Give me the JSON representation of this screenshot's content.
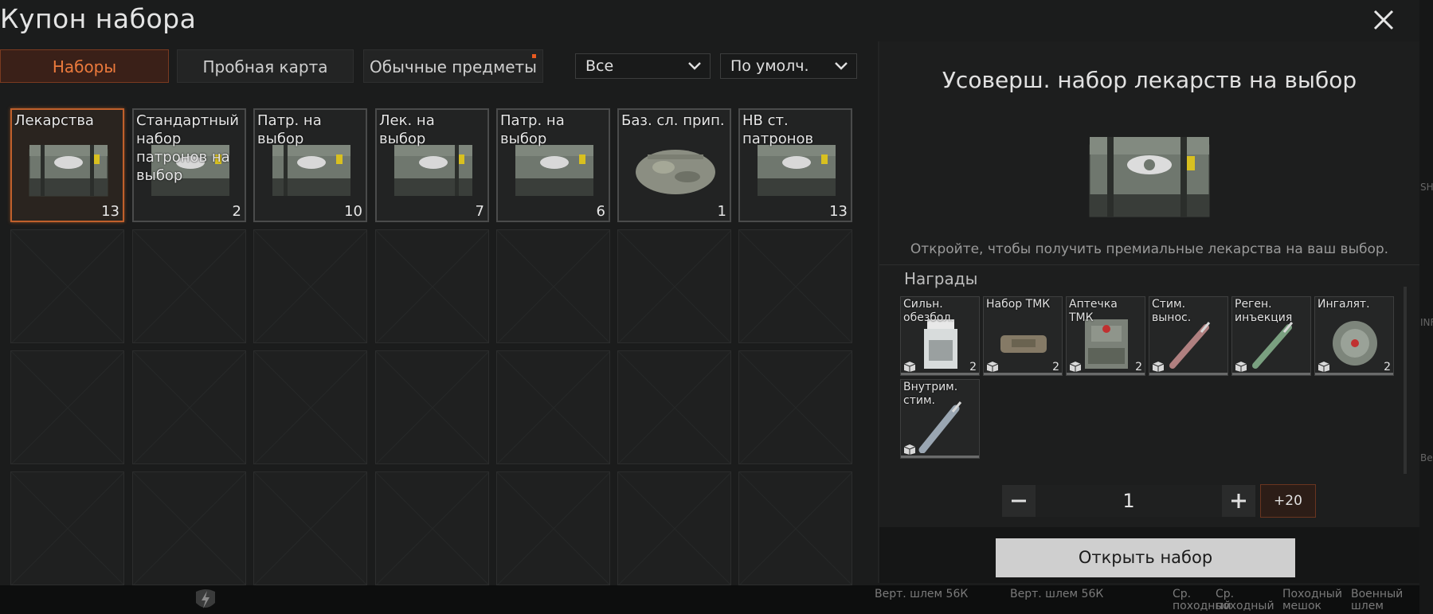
{
  "window": {
    "title": "Купон набора"
  },
  "tabs": [
    {
      "label": "Наборы",
      "active": true
    },
    {
      "label": "Пробная карта",
      "active": false
    },
    {
      "label": "Обычные предметы",
      "active": false,
      "has_dot": true
    }
  ],
  "filters": {
    "category": "Все",
    "sort": "По умолч."
  },
  "grid": {
    "items": [
      {
        "label": "Лекарства",
        "count": "13",
        "icon": "medical-crate-icon",
        "selected": true
      },
      {
        "label": "Стандартный набор патронов на выбор",
        "count": "2",
        "icon": "ammo-crate-icon"
      },
      {
        "label": "Патр. на выбор",
        "count": "10",
        "icon": "ammo-crate-icon"
      },
      {
        "label": "Лек. на выбор",
        "count": "7",
        "icon": "medical-crate-icon"
      },
      {
        "label": "Патр. на выбор",
        "count": "6",
        "icon": "ammo-crate-icon"
      },
      {
        "label": "Баз. сл. прип.",
        "count": "1",
        "icon": "duffel-bag-icon"
      },
      {
        "label": "НВ ст. патронов",
        "count": "13",
        "icon": "ammo-crate-icon"
      }
    ]
  },
  "detail": {
    "title": "Усоверш. набор лекарств на выбор",
    "description": "Откройте, чтобы получить премиальные лекарства на ваш выбор.",
    "rewards_header": "Награды",
    "rewards": [
      {
        "label": "Сильн. обезбол.",
        "count": "2",
        "icon": "painkiller-bottle-icon"
      },
      {
        "label": "Набор ТМК",
        "count": "2",
        "icon": "tmk-kit-icon"
      },
      {
        "label": "Аптечка ТМК",
        "count": "2",
        "icon": "medkit-pouch-icon"
      },
      {
        "label": "Стим. вынос.",
        "count": "",
        "icon": "stim-syringe-icon"
      },
      {
        "label": "Реген. инъекция",
        "count": "",
        "icon": "regen-injector-icon"
      },
      {
        "label": "Ингалят.",
        "count": "2",
        "icon": "inhaler-icon"
      },
      {
        "label": "Внутрим. стим.",
        "count": "",
        "icon": "injector-pen-icon"
      }
    ],
    "quantity": {
      "value": "1",
      "plus20_label": "+20"
    },
    "open_button": "Открыть набор"
  },
  "bottom_strip": [
    "Верт. шлем 56К",
    "Верт. шлем 56К",
    "Ср. походный",
    "Ср. походный",
    "Походный мешок",
    "Военный шлем"
  ],
  "edge_labels": [
    "SH",
    "INF",
    "Ве"
  ],
  "colors": {
    "accent": "#ec7a3c",
    "selected_border": "#c0602c",
    "open_button_bg": "#cfcfcf"
  }
}
